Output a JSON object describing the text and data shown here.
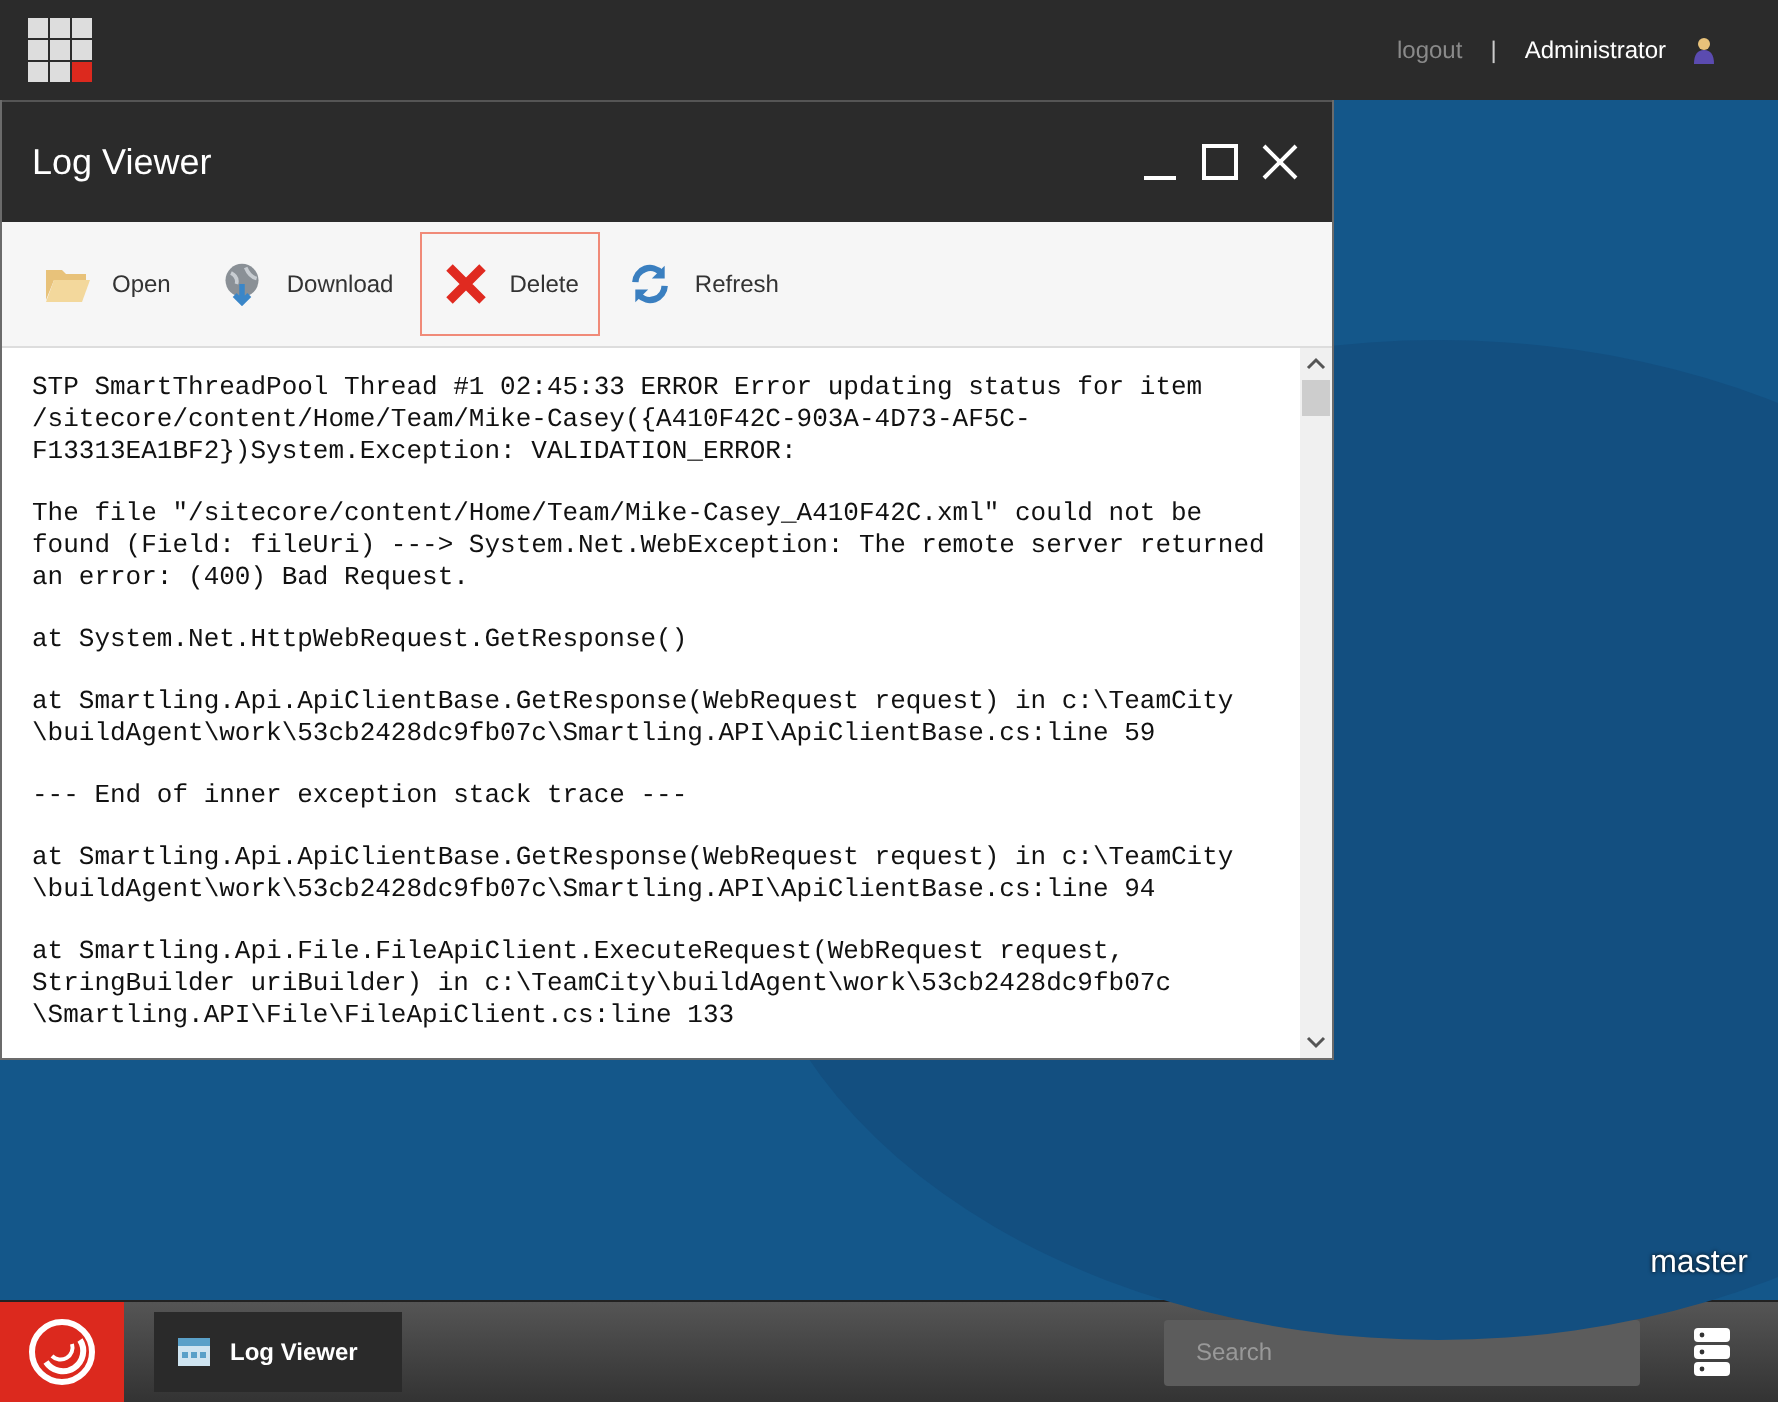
{
  "top_bar": {
    "logout": "logout",
    "separator": "|",
    "user": "Administrator"
  },
  "window": {
    "title": "Log Viewer"
  },
  "toolbar": [
    {
      "label": "Open",
      "kind": "folder",
      "selected": false
    },
    {
      "label": "Download",
      "kind": "globe",
      "selected": false
    },
    {
      "label": "Delete",
      "kind": "delete",
      "selected": true
    },
    {
      "label": "Refresh",
      "kind": "refresh",
      "selected": false
    }
  ],
  "log": [
    "STP SmartThreadPool Thread #1 02:45:33 ERROR Error updating status for item /sitecore/content/Home/Team/Mike-Casey({A410F42C-903A-4D73-AF5C-F13313EA1BF2})System.Exception: VALIDATION_ERROR:",
    "The file \"/sitecore/content/Home/Team/Mike-Casey_A410F42C.xml\" could not be found (Field: fileUri) ---> System.Net.WebException: The remote server returned an error: (400) Bad Request.",
    "at System.Net.HttpWebRequest.GetResponse()",
    "at Smartling.Api.ApiClientBase.GetResponse(WebRequest request) in c:\\TeamCity \\buildAgent\\work\\53cb2428dc9fb07c\\Smartling.API\\ApiClientBase.cs:line 59",
    "--- End of inner exception stack trace ---",
    "at Smartling.Api.ApiClientBase.GetResponse(WebRequest request) in c:\\TeamCity \\buildAgent\\work\\53cb2428dc9fb07c\\Smartling.API\\ApiClientBase.cs:line 94",
    "at Smartling.Api.File.FileApiClient.ExecuteRequest(WebRequest request, StringBuilder uriBuilder) in c:\\TeamCity\\buildAgent\\work\\53cb2428dc9fb07c \\Smartling.API\\File\\FileApiClient.cs:line 133"
  ],
  "desktop": {
    "database": "master"
  },
  "taskbar": {
    "task": "Log Viewer",
    "search": {
      "placeholder": "Search"
    }
  }
}
